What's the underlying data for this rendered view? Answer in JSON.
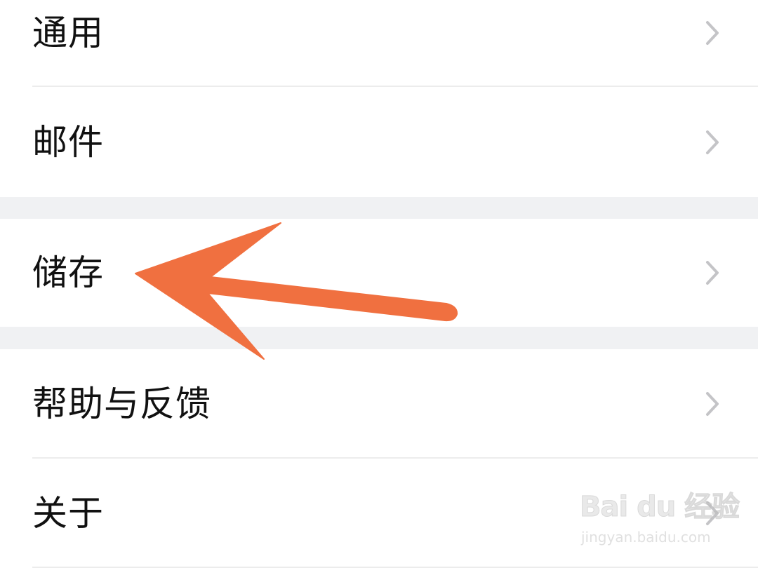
{
  "settings": {
    "groups": [
      {
        "items": [
          {
            "label": "通用"
          },
          {
            "label": "邮件"
          }
        ]
      },
      {
        "items": [
          {
            "label": "储存"
          }
        ]
      },
      {
        "items": [
          {
            "label": "帮助与反馈"
          },
          {
            "label": "关于"
          }
        ]
      }
    ]
  },
  "annotation": {
    "arrow_color": "#f07040",
    "target": "储存"
  },
  "watermark": {
    "logo_text": "Bai du 经验",
    "url_text": "jingyan.baidu.com"
  },
  "icons": {
    "chevron": "chevron-right-icon",
    "arrow": "annotation-arrow-icon"
  },
  "colors": {
    "background": "#f0f1f3",
    "row_background": "#ffffff",
    "text": "#111111",
    "chevron": "#c4c4c7",
    "divider": "#ececec"
  }
}
